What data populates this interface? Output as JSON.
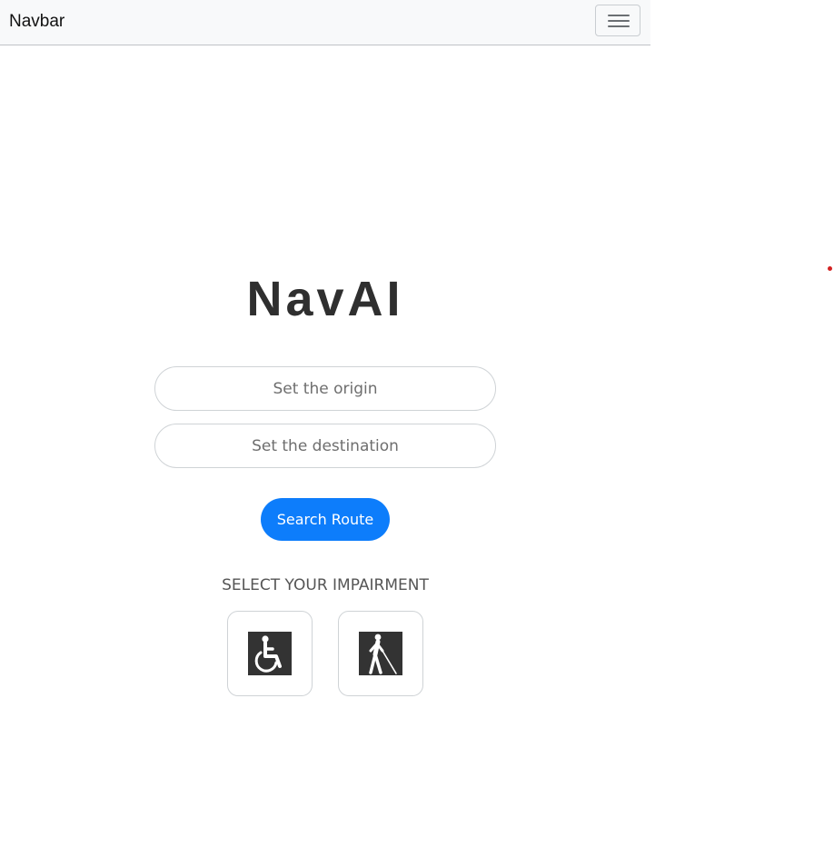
{
  "navbar": {
    "brand": "Navbar",
    "toggler_icon": "hamburger-menu-icon"
  },
  "main": {
    "title": "NavAI",
    "origin_placeholder": "Set the origin",
    "destination_placeholder": "Set the destination",
    "origin_value": "",
    "destination_value": "",
    "search_label": "Search Route",
    "impairment_heading": "SELECT YOUR IMPAIRMENT",
    "impairments": [
      {
        "icon": "wheelchair-icon"
      },
      {
        "icon": "blind-person-cane-icon"
      }
    ]
  },
  "colors": {
    "accent": "#0d7dfb",
    "navbar_bg": "#f8f9fa",
    "title": "#2f2f2f",
    "icon_bg": "#333333",
    "marker": "#d32222"
  }
}
